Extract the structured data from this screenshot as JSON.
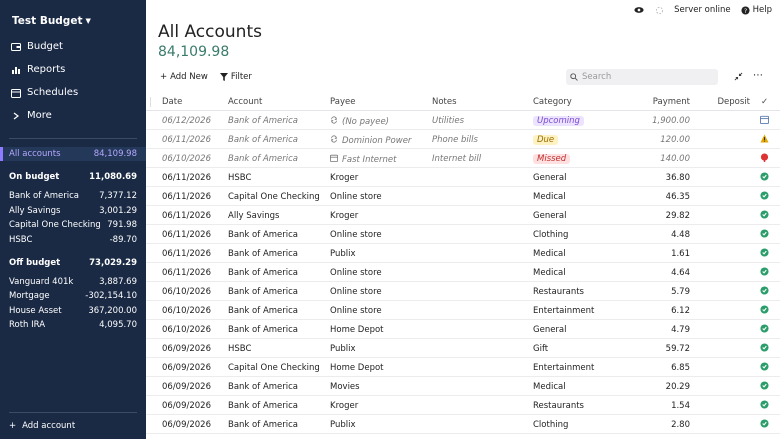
{
  "sidebar": {
    "budget_name": "Test Budget",
    "nav": [
      {
        "label": "Budget",
        "icon": "wallet-icon"
      },
      {
        "label": "Reports",
        "icon": "bar-chart-icon"
      },
      {
        "label": "Schedules",
        "icon": "calendar-icon"
      },
      {
        "label": "More",
        "icon": "chevron-right-icon"
      }
    ],
    "all_accounts": {
      "label": "All accounts",
      "value": "84,109.98"
    },
    "on_budget": {
      "label": "On budget",
      "value": "11,080.69"
    },
    "on_budget_accounts": [
      {
        "label": "Bank of America",
        "value": "7,377.12"
      },
      {
        "label": "Ally Savings",
        "value": "3,001.29"
      },
      {
        "label": "Capital One Checking",
        "value": "791.98"
      },
      {
        "label": "HSBC",
        "value": "-89.70"
      }
    ],
    "off_budget": {
      "label": "Off budget",
      "value": "73,029.29"
    },
    "off_budget_accounts": [
      {
        "label": "Vanguard 401k",
        "value": "3,887.69"
      },
      {
        "label": "Mortgage",
        "value": "-302,154.10"
      },
      {
        "label": "House Asset",
        "value": "367,200.00"
      },
      {
        "label": "Roth IRA",
        "value": "4,095.70"
      }
    ],
    "add_account": "Add account"
  },
  "topbar": {
    "server_status": "Server online",
    "help": "Help"
  },
  "main": {
    "title": "All Accounts",
    "balance": "84,109.98",
    "add_new": "Add New",
    "filter": "Filter",
    "search_placeholder": "Search"
  },
  "table": {
    "headers": {
      "date": "Date",
      "account": "Account",
      "payee": "Payee",
      "notes": "Notes",
      "category": "Category",
      "payment": "Payment",
      "deposit": "Deposit",
      "status": "✓"
    },
    "rows": [
      {
        "date": "06/12/2026",
        "account": "Bank of America",
        "payee": "(No payee)",
        "payee_icon": "recurring-icon",
        "notes": "Utilities",
        "category": "Upcoming",
        "badge": "upcoming",
        "payment": "1,900.00",
        "deposit": "",
        "status": "calendar",
        "scheduled": true
      },
      {
        "date": "06/11/2026",
        "account": "Bank of America",
        "payee": "Dominion Power",
        "payee_icon": "recurring-icon",
        "notes": "Phone bills",
        "category": "Due",
        "badge": "due",
        "payment": "120.00",
        "deposit": "",
        "status": "warning",
        "scheduled": true
      },
      {
        "date": "06/10/2026",
        "account": "Bank of America",
        "payee": "Fast Internet",
        "payee_icon": "calendar-icon",
        "notes": "Internet bill",
        "category": "Missed",
        "badge": "missed",
        "payment": "140.00",
        "deposit": "",
        "status": "missed",
        "scheduled": true
      },
      {
        "date": "06/11/2026",
        "account": "HSBC",
        "payee": "Kroger",
        "notes": "",
        "category": "General",
        "payment": "36.80",
        "deposit": "",
        "status": "cleared"
      },
      {
        "date": "06/11/2026",
        "account": "Capital One Checking",
        "payee": "Online store",
        "notes": "",
        "category": "Medical",
        "payment": "46.35",
        "deposit": "",
        "status": "cleared"
      },
      {
        "date": "06/11/2026",
        "account": "Ally Savings",
        "payee": "Kroger",
        "notes": "",
        "category": "General",
        "payment": "29.82",
        "deposit": "",
        "status": "cleared"
      },
      {
        "date": "06/11/2026",
        "account": "Bank of America",
        "payee": "Online store",
        "notes": "",
        "category": "Clothing",
        "payment": "4.48",
        "deposit": "",
        "status": "cleared"
      },
      {
        "date": "06/11/2026",
        "account": "Bank of America",
        "payee": "Publix",
        "notes": "",
        "category": "Medical",
        "payment": "1.61",
        "deposit": "",
        "status": "cleared"
      },
      {
        "date": "06/11/2026",
        "account": "Bank of America",
        "payee": "Online store",
        "notes": "",
        "category": "Medical",
        "payment": "4.64",
        "deposit": "",
        "status": "cleared"
      },
      {
        "date": "06/10/2026",
        "account": "Bank of America",
        "payee": "Online store",
        "notes": "",
        "category": "Restaurants",
        "payment": "5.79",
        "deposit": "",
        "status": "cleared"
      },
      {
        "date": "06/10/2026",
        "account": "Bank of America",
        "payee": "Online store",
        "notes": "",
        "category": "Entertainment",
        "payment": "6.12",
        "deposit": "",
        "status": "cleared"
      },
      {
        "date": "06/10/2026",
        "account": "Bank of America",
        "payee": "Home Depot",
        "notes": "",
        "category": "General",
        "payment": "4.79",
        "deposit": "",
        "status": "cleared"
      },
      {
        "date": "06/09/2026",
        "account": "HSBC",
        "payee": "Publix",
        "notes": "",
        "category": "Gift",
        "payment": "59.72",
        "deposit": "",
        "status": "cleared"
      },
      {
        "date": "06/09/2026",
        "account": "Capital One Checking",
        "payee": "Home Depot",
        "notes": "",
        "category": "Entertainment",
        "payment": "6.85",
        "deposit": "",
        "status": "cleared"
      },
      {
        "date": "06/09/2026",
        "account": "Bank of America",
        "payee": "Movies",
        "notes": "",
        "category": "Medical",
        "payment": "20.29",
        "deposit": "",
        "status": "cleared"
      },
      {
        "date": "06/09/2026",
        "account": "Bank of America",
        "payee": "Kroger",
        "notes": "",
        "category": "Restaurants",
        "payment": "1.54",
        "deposit": "",
        "status": "cleared"
      },
      {
        "date": "06/09/2026",
        "account": "Bank of America",
        "payee": "Publix",
        "notes": "",
        "category": "Clothing",
        "payment": "2.80",
        "deposit": "",
        "status": "cleared"
      }
    ]
  }
}
